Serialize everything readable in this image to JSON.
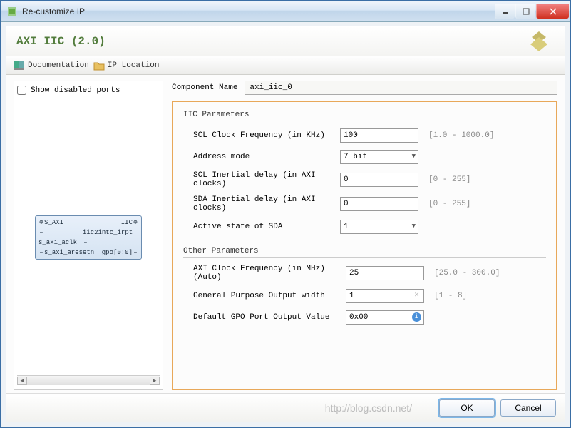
{
  "window": {
    "title": "Re-customize IP"
  },
  "header": {
    "title": "AXI IIC (2.0)"
  },
  "toolbar": {
    "documentation": "Documentation",
    "ip_location": "IP Location"
  },
  "left": {
    "show_disabled_label": "Show disabled ports",
    "block": {
      "left1": "S_AXI",
      "right1": "IIC",
      "left2": "s_axi_aclk",
      "right2": "iic2intc_irpt",
      "left3": "s_axi_aresetn",
      "right3": "gpo[0:0]"
    }
  },
  "comp": {
    "label": "Component Name",
    "value": "axi_iic_0"
  },
  "iic": {
    "title": "IIC Parameters",
    "scl_freq_label": "SCL Clock Frequency (in KHz)",
    "scl_freq_value": "100",
    "scl_freq_range": "[1.0 - 1000.0]",
    "addr_mode_label": "Address mode",
    "addr_mode_value": "7 bit",
    "scl_delay_label": "SCL Inertial delay (in AXI clocks)",
    "scl_delay_value": "0",
    "scl_delay_range": "[0 - 255]",
    "sda_delay_label": "SDA Inertial delay (in AXI clocks)",
    "sda_delay_value": "0",
    "sda_delay_range": "[0 - 255]",
    "active_sda_label": "Active state of SDA",
    "active_sda_value": "1"
  },
  "other": {
    "title": "Other Parameters",
    "axi_clk_label": "AXI Clock Frequency (in MHz) (Auto)",
    "axi_clk_value": "25",
    "axi_clk_range": "[25.0 - 300.0]",
    "gpo_width_label": "General Purpose Output width",
    "gpo_width_value": "1",
    "gpo_width_range": "[1 - 8]",
    "gpo_default_label": "Default GPO Port Output Value",
    "gpo_default_value": "0x00"
  },
  "footer": {
    "watermark": "http://blog.csdn.net/",
    "ok": "OK",
    "cancel": "Cancel"
  }
}
